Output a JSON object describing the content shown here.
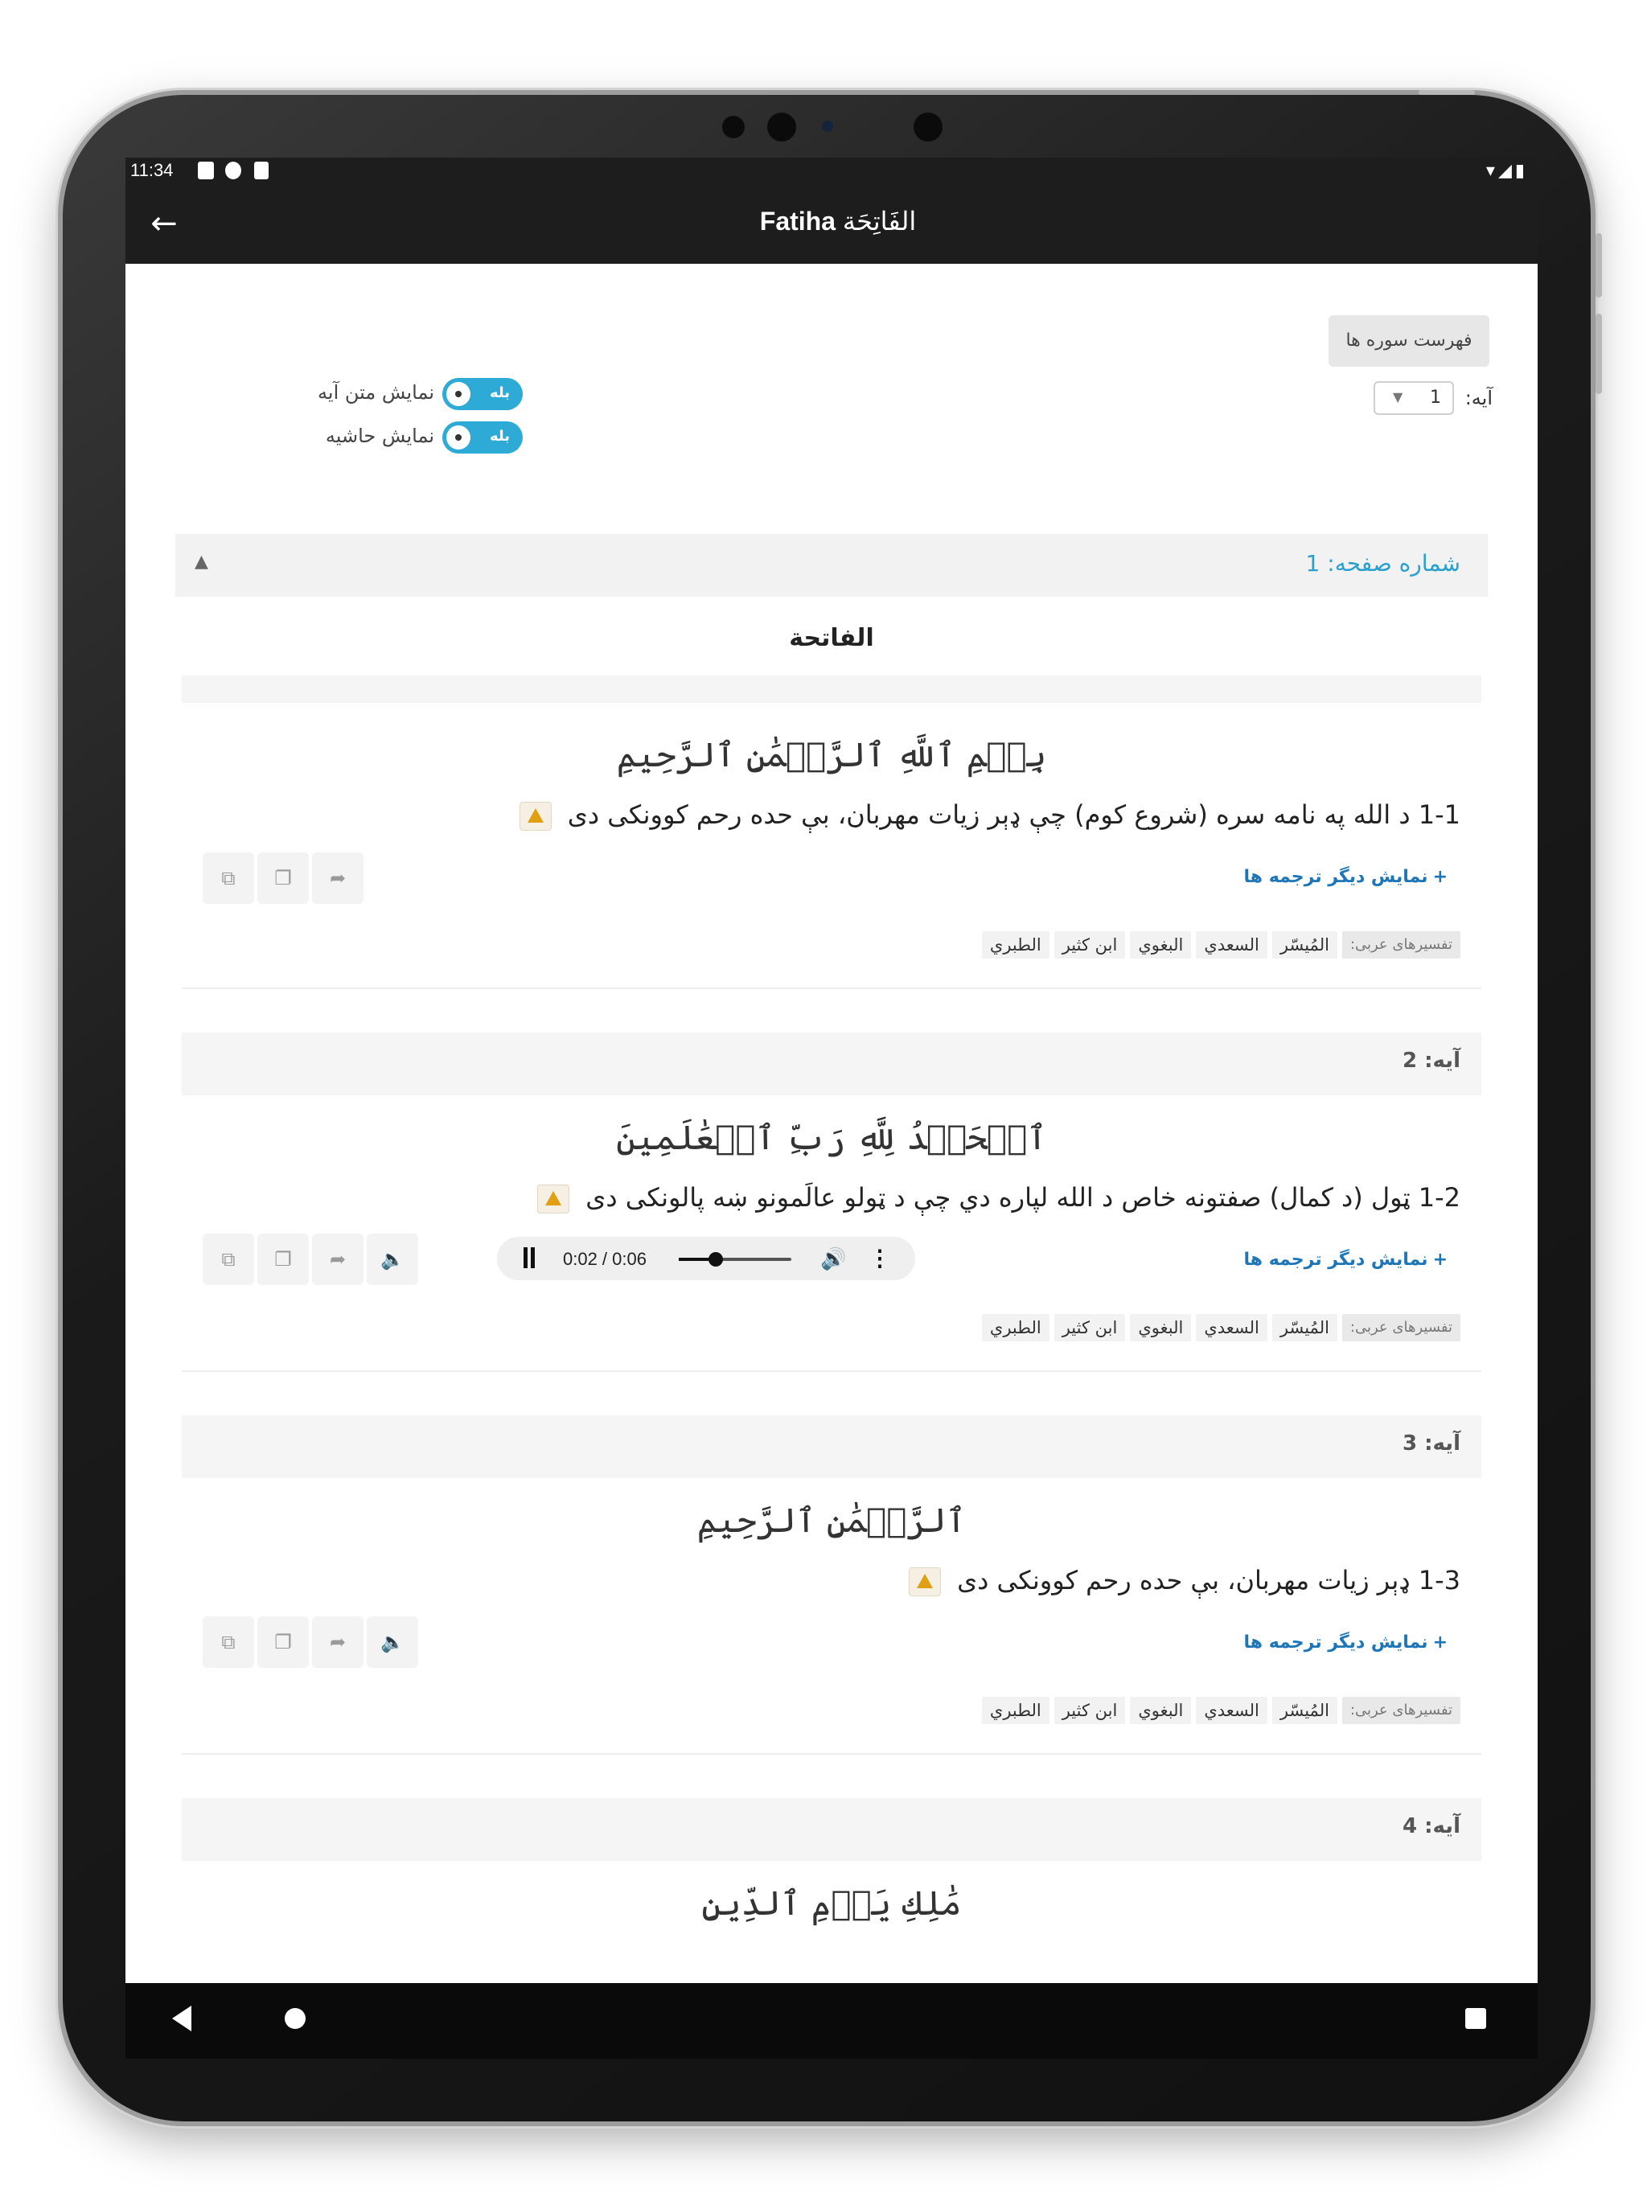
{
  "statusbar": {
    "time": "11:34"
  },
  "appbar": {
    "title_latin": "Fatiha",
    "title_arabic": "الفَاتِحَة"
  },
  "controls": {
    "surah_list_button": "فهرست سوره ها",
    "ayah_label": "آیه:",
    "ayah_value": "1",
    "toggles": [
      {
        "label": "نمایش متن آیه",
        "state": "بله",
        "on": true
      },
      {
        "label": "نمایش حاشیه",
        "state": "بله",
        "on": true
      }
    ]
  },
  "page_header": "شماره صفحه: 1",
  "surah_name": "الفاتحة",
  "more_translations": "نمایش دیگر ترجمه ها",
  "tafsir_label": "تفسیرهای عربی:",
  "tafsirs": [
    "المُيسّر",
    "السعدي",
    "البغوي",
    "ابن كثير",
    "الطبري"
  ],
  "ayahs": [
    {
      "title": "",
      "arabic": "بِسۡمِ ٱللَّهِ ٱلرَّحۡمَٰنِ ٱلرَّحِيمِ",
      "translation": "1-1 د الله په نامه سره (شروع کوم) چې ډېر زيات مهربان، بې حده رحم کوونکى دى"
    },
    {
      "title": "آیه: 2",
      "arabic": "ٱلۡحَمۡدُ لِلَّهِ رَبِّ ٱلۡعَٰلَمِينَ",
      "translation": "1-2 ټول (د کمال) صفتونه خاص د الله لپاره دي چې د ټولو عالَمونو ښه پالونکى دى",
      "player": {
        "current": "0:02",
        "duration": "0:06",
        "time_text": "0:02 / 0:06",
        "progress": 0.33
      }
    },
    {
      "title": "آیه: 3",
      "arabic": "ٱلرَّحۡمَٰنِ ٱلرَّحِيمِ",
      "translation": "1-3 ډېر زيات مهربان، بې حده رحم کوونکى دى"
    },
    {
      "title": "آیه: 4",
      "arabic": "مَٰلِكِ يَوۡمِ ٱلدِّينِ"
    }
  ],
  "icons": {
    "back": "arrow-left-icon",
    "open": "external-link-icon",
    "copy": "copy-icon",
    "share": "share-icon",
    "audio": "speaker-icon",
    "warning": "warning-icon"
  },
  "colors": {
    "accent": "#2aa0cf",
    "link": "#1d76b8",
    "appbar": "#1d1d1d"
  }
}
